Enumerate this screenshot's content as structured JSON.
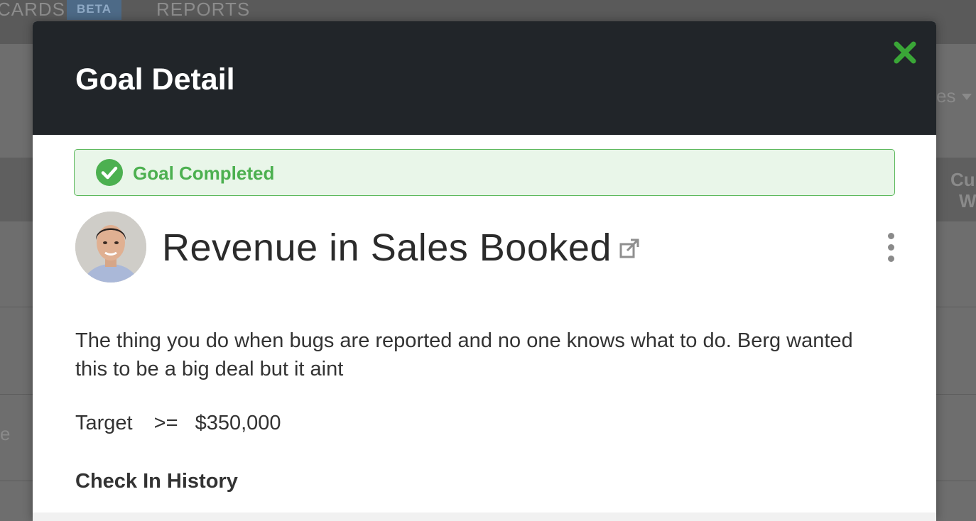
{
  "background": {
    "nav": {
      "cards_label": "CARDS",
      "beta_badge": "BETA",
      "reports_label": "REPORTS"
    },
    "right_fragments": [
      "es",
      "Cu",
      "W",
      "e"
    ]
  },
  "modal": {
    "title": "Goal Detail",
    "close_icon": "close-x-icon",
    "status": {
      "icon": "check-circle-icon",
      "text": "Goal Completed",
      "color": "#4cb050"
    },
    "goal": {
      "avatar": "avatar",
      "title": "Revenue in Sales Booked",
      "external_link_icon": "external-link-icon",
      "menu_icon": "kebab-menu-icon",
      "description": "The thing you do when bugs are reported and no one knows what to do. Berg wanted this to be a big deal but it aint",
      "target": {
        "label": "Target",
        "operator": ">=",
        "value": "$350,000"
      }
    },
    "check_in_history_heading": "Check In History"
  },
  "colors": {
    "header_bg": "#212529",
    "success": "#4cb050",
    "success_bg": "#e9f6e9",
    "close": "#3aa637"
  }
}
